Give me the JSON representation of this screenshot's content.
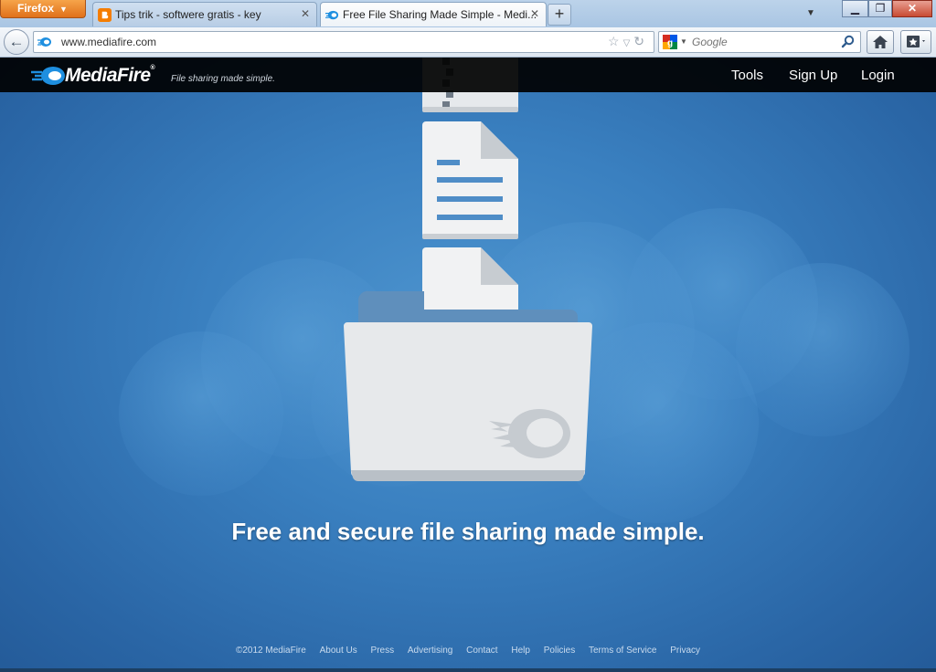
{
  "browser": {
    "app_button": "Firefox",
    "tabs": [
      {
        "title": "Tips trik - softwere gratis - key",
        "active": false
      },
      {
        "title": "Free File Sharing Made Simple - Medi...",
        "active": true
      }
    ],
    "url": "www.mediafire.com",
    "search_placeholder": "Google"
  },
  "site": {
    "brand": "MediaFire",
    "registered": "®",
    "tagline": "File sharing made simple.",
    "nav": [
      "Tools",
      "Sign Up",
      "Login"
    ],
    "headline": "Free and secure file sharing made simple.",
    "footer_links": [
      "©2012 MediaFire",
      "About Us",
      "Press",
      "Advertising",
      "Contact",
      "Help",
      "Policies",
      "Terms of Service",
      "Privacy"
    ]
  },
  "colors": {
    "page_bg": "#3a80c0",
    "header_bg": "#000000",
    "accent_blue": "#1e8fe0"
  },
  "icons": {
    "app_menu": "firefox-menu-icon",
    "tab_favicon_1": "blogger-icon",
    "tab_favicon_2": "mediafire-icon",
    "back": "back-arrow-icon",
    "home": "home-icon",
    "bookmarks": "bookmarks-icon",
    "illustration": [
      "zip-file-icon",
      "document-icon",
      "file-icon",
      "folder-icon"
    ]
  }
}
